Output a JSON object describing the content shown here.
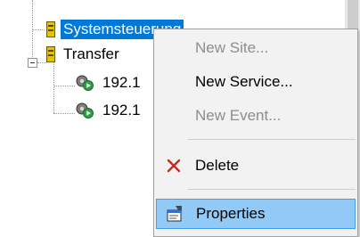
{
  "tree": {
    "nodes": [
      {
        "label": "Systemsteuerung",
        "selected": true
      },
      {
        "label": "Transfer",
        "selected": false
      },
      {
        "label": "192.1",
        "selected": false
      },
      {
        "label": "192.1",
        "selected": false
      }
    ]
  },
  "context_menu": {
    "items": [
      {
        "label": "New Site...",
        "enabled": false
      },
      {
        "label": "New Service...",
        "enabled": true
      },
      {
        "label": "New Event...",
        "enabled": false
      },
      {
        "label": "Delete",
        "enabled": true,
        "icon": "delete-x-icon"
      },
      {
        "label": "Properties",
        "enabled": true,
        "highlighted": true,
        "icon": "properties-icon"
      }
    ]
  },
  "colors": {
    "selection": "#0078d7",
    "menu_background": "#f2f2f2",
    "menu_highlight": "#91c9f7",
    "disabled_text": "#8d8d8d",
    "delete_icon": "#c42b1c"
  }
}
